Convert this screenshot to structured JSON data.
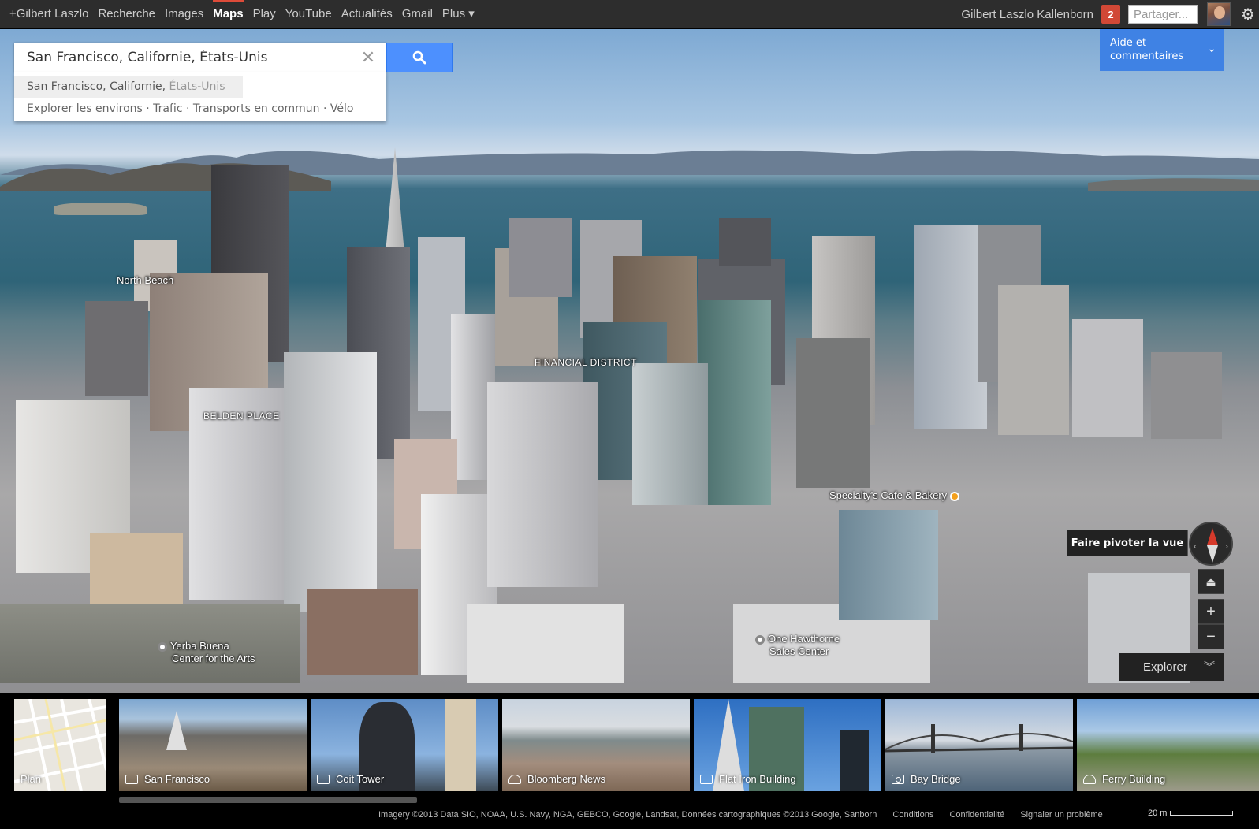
{
  "gbar": {
    "nav": [
      {
        "label": "+Gilbert Laszlo",
        "active": false
      },
      {
        "label": "Recherche",
        "active": false
      },
      {
        "label": "Images",
        "active": false
      },
      {
        "label": "Maps",
        "active": true
      },
      {
        "label": "Play",
        "active": false
      },
      {
        "label": "YouTube",
        "active": false
      },
      {
        "label": "Actualités",
        "active": false
      },
      {
        "label": "Gmail",
        "active": false
      },
      {
        "label": "Plus ▾",
        "active": false
      }
    ],
    "user_name": "Gilbert Laszlo Kallenborn",
    "notification_count": "2",
    "share_placeholder": "Partager...",
    "settings_icon": "gear-icon"
  },
  "search": {
    "value": "San Francisco, Californie, États-Unis",
    "suggestion_main": "San Francisco, Californie, ",
    "suggestion_muted": "États-Unis",
    "links": "Explorer les environs · Trafic · Transports en commun · Vélo"
  },
  "help": {
    "label": "Aide et commentaires",
    "line1": "Aide et",
    "line2": "commentaires"
  },
  "map_labels": {
    "north_beach": "North Beach",
    "financial_district": "FINANCIAL DISTRICT",
    "belden_place": "BELDEN PLACE",
    "specialtys": "Specialty's Cafe & Bakery",
    "yerba1": "Yerba Buena",
    "yerba2": "Center for the Arts",
    "hawthorne1": "One Hawthorne",
    "hawthorne2": "Sales Center"
  },
  "controls": {
    "rotate_tooltip": "Faire pivoter la vue",
    "zoom_in": "+",
    "zoom_out": "−",
    "explore": "Explorer"
  },
  "carousel": [
    {
      "label": "Plan",
      "type": "map"
    },
    {
      "label": "San Francisco",
      "type": "photo-set"
    },
    {
      "label": "Coit Tower",
      "type": "photo-set"
    },
    {
      "label": "Bloomberg News",
      "type": "panorama"
    },
    {
      "label": "Flat Iron Building",
      "type": "photo-set"
    },
    {
      "label": "Bay Bridge",
      "type": "photo"
    },
    {
      "label": "Ferry Building",
      "type": "panorama"
    }
  ],
  "footer": {
    "imagery": "Imagery ©2013 Data SIO, NOAA, U.S. Navy, NGA, GEBCO, Google, Landsat, Données cartographiques ©2013 Google, Sanborn",
    "terms": "Conditions",
    "privacy": "Confidentialité",
    "report": "Signaler un problème",
    "scale": "20 m"
  },
  "colors": {
    "accent_blue": "#4d90fe",
    "help_blue": "#3f82e4",
    "notif_red": "#d14836",
    "bar_bg": "#2d2d2d"
  }
}
